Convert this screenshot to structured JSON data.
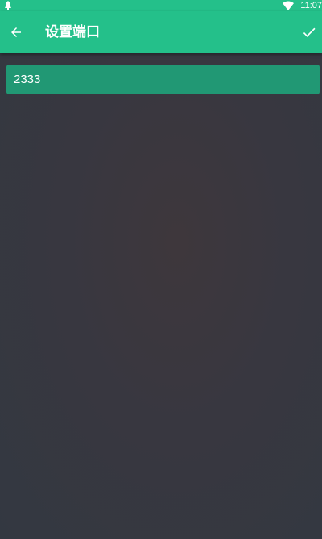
{
  "status_bar": {
    "time": "11:07",
    "left_icon": "notification-icon",
    "wifi_icon": "wifi-icon"
  },
  "app_bar": {
    "title": "设置端口",
    "back_icon": "arrow-back-icon",
    "confirm_icon": "check-icon",
    "color": "#24c08a"
  },
  "port_field": {
    "value": "2333",
    "background": "#219874"
  }
}
